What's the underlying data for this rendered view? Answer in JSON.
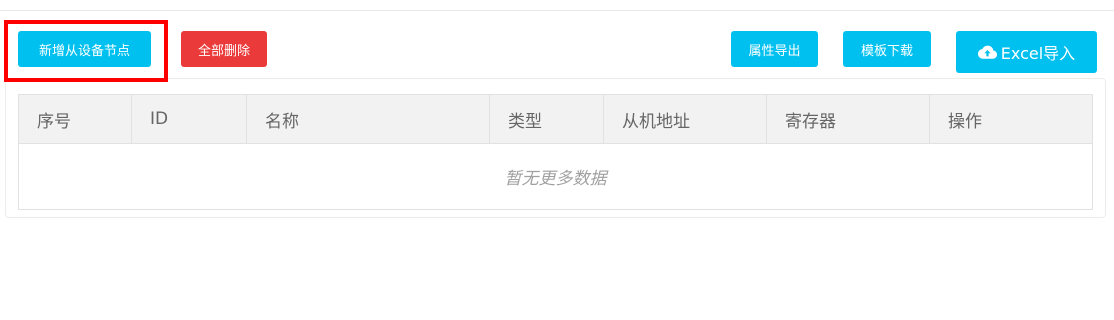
{
  "toolbar": {
    "add_label": "新增从设备节点",
    "delete_all_label": "全部删除",
    "export_label": "属性导出",
    "template_label": "模板下载",
    "excel_import_label": "Excel导入",
    "excel_icon": "cloud-upload-icon"
  },
  "table": {
    "columns": [
      "序号",
      "ID",
      "名称",
      "类型",
      "从机地址",
      "寄存器",
      "操作"
    ],
    "empty_text": "暂无更多数据"
  },
  "colors": {
    "info": "#00c0ef",
    "danger": "#ea3a39",
    "highlight": "#ff0000"
  }
}
